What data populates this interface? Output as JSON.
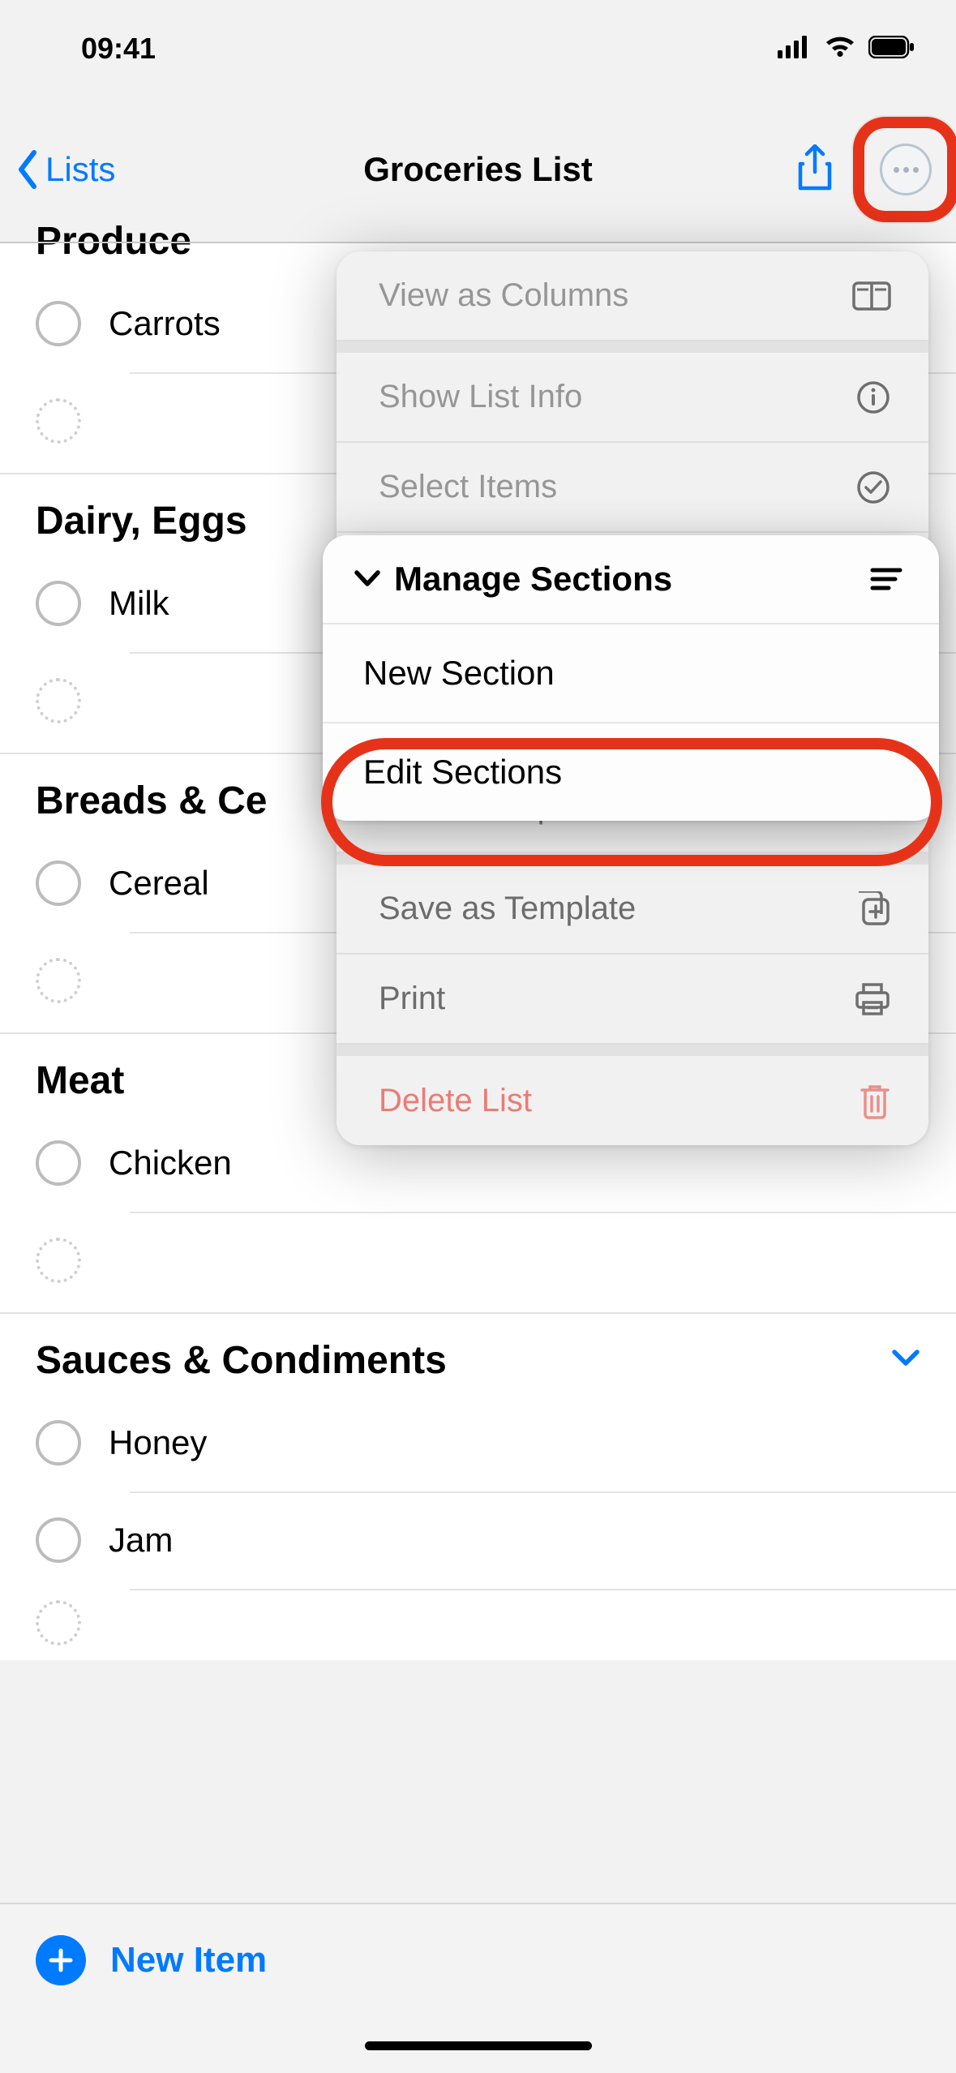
{
  "status": {
    "time": "09:41"
  },
  "nav": {
    "back_label": "Lists",
    "title": "Groceries List"
  },
  "sections": [
    {
      "title": "Produce",
      "items": [
        "Carrots"
      ],
      "truncated": "Produce"
    },
    {
      "title": "Dairy, Eggs",
      "items": [
        "Milk"
      ]
    },
    {
      "title_visible": "Breads & Ce",
      "title": "Breads & Cereals",
      "items": [
        "Cereal"
      ]
    },
    {
      "title": "Meat",
      "items": [
        "Chicken"
      ]
    },
    {
      "title": "Sauces & Condiments",
      "items": [
        "Honey",
        "Jam"
      ],
      "expandable": true
    }
  ],
  "popup": {
    "items": [
      {
        "label": "View as Columns",
        "icon": "columns"
      },
      {
        "label": "Show List Info",
        "icon": "info"
      },
      {
        "label": "Select Items",
        "icon": "check-circle"
      },
      {
        "label": "Show Completed",
        "icon": "eye"
      },
      {
        "label": "Save as Template",
        "icon": "duplicate"
      },
      {
        "label": "Print",
        "icon": "printer"
      },
      {
        "label": "Delete List",
        "icon": "trash",
        "danger": true
      }
    ]
  },
  "submenu": {
    "header": "Manage Sections",
    "items": [
      "New Section",
      "Edit Sections"
    ]
  },
  "footer": {
    "new_item_label": "New Item"
  }
}
